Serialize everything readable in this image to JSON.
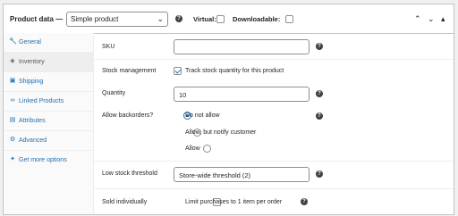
{
  "header": {
    "title": "Product data —",
    "product_type": "Simple product",
    "virtual_label": "Virtual:",
    "downloadable_label": "Downloadable:",
    "virtual_checked": false,
    "downloadable_checked": false
  },
  "sidebar": {
    "items": [
      {
        "label": "General",
        "icon": "wrench-icon",
        "active": false
      },
      {
        "label": "Inventory",
        "icon": "tag-icon",
        "active": true
      },
      {
        "label": "Shipping",
        "icon": "truck-icon",
        "active": false
      },
      {
        "label": "Linked Products",
        "icon": "link-icon",
        "active": false
      },
      {
        "label": "Attributes",
        "icon": "list-icon",
        "active": false
      },
      {
        "label": "Advanced",
        "icon": "gear-icon",
        "active": false
      },
      {
        "label": "Get more options",
        "icon": "plugin-icon",
        "active": false
      }
    ]
  },
  "inventory": {
    "sku_label": "SKU",
    "sku_value": "",
    "stock_mgmt_label": "Stock management",
    "stock_mgmt_checkbox_label": "Track stock quantity for this product",
    "stock_mgmt_checked": true,
    "quantity_label": "Quantity",
    "quantity_value": "10",
    "backorders_label": "Allow backorders?",
    "backorder_options": [
      {
        "label": "Do not allow",
        "selected": true
      },
      {
        "label": "Allow, but notify customer",
        "selected": false
      },
      {
        "label": "Allow",
        "selected": false
      }
    ],
    "low_stock_label": "Low stock threshold",
    "low_stock_value": "Store-wide threshold (2)",
    "sold_individually_label": "Sold individually",
    "sold_individually_checkbox_label": "Limit purchases to 1 item per order",
    "sold_individually_checked": false
  },
  "colors": {
    "accent": "#2271b1",
    "border": "#c3c4c7"
  }
}
